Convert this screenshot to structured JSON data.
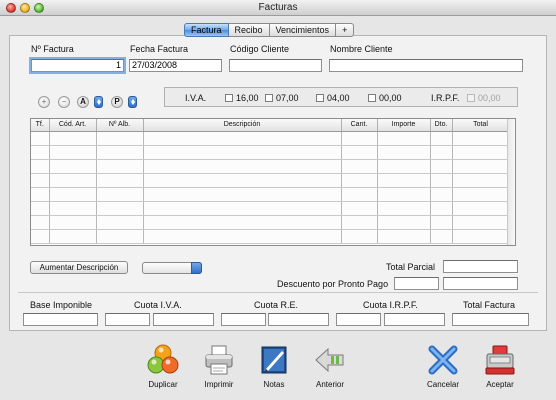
{
  "window": {
    "title": "Facturas"
  },
  "tabs": [
    {
      "label": "Factura",
      "active": true
    },
    {
      "label": "Recibo",
      "active": false
    },
    {
      "label": "Vencimientos",
      "active": false
    },
    {
      "label": "+",
      "active": false
    }
  ],
  "header": {
    "num_factura_label": "Nº Factura",
    "num_factura_value": "1",
    "fecha_label": "Fecha Factura",
    "fecha_value": "27/03/2008",
    "codigo_label": "Código Cliente",
    "codigo_value": "",
    "nombre_label": "Nombre Cliente",
    "nombre_value": ""
  },
  "iva": {
    "label": "I.V.A.",
    "options": [
      "16,00",
      "07,00",
      "04,00",
      "00,00"
    ],
    "irpf_label": "I.R.P.F.",
    "irpf_value": "00,00"
  },
  "row_tools": {
    "add": "+",
    "remove": "−",
    "a_label": "A",
    "p_label": "P"
  },
  "table": {
    "columns": [
      "Tf.",
      "Cód. Art.",
      "Nº Alb.",
      "Descripción",
      "Cant.",
      "Importe",
      "Dto.",
      "Total"
    ],
    "row_count": 8
  },
  "controls": {
    "aumentar_label": "Aumentar Descripción",
    "total_parcial_label": "Total Parcial",
    "descuento_label": "Descuento por Pronto Pago"
  },
  "summary": {
    "base_label": "Base Imponible",
    "cuota_iva_label": "Cuota I.V.A.",
    "cuota_re_label": "Cuota R.E.",
    "cuota_irpf_label": "Cuota I.R.P.F.",
    "total_label": "Total Factura"
  },
  "toolbar": {
    "duplicar": "Duplicar",
    "imprimir": "Imprimir",
    "notas": "Notas",
    "anterior": "Anterior",
    "cancelar": "Cancelar",
    "aceptar": "Aceptar"
  },
  "colors": {
    "accent": "#4a8ee0",
    "panel": "#f2f2f2",
    "window": "#e6e6e6"
  }
}
